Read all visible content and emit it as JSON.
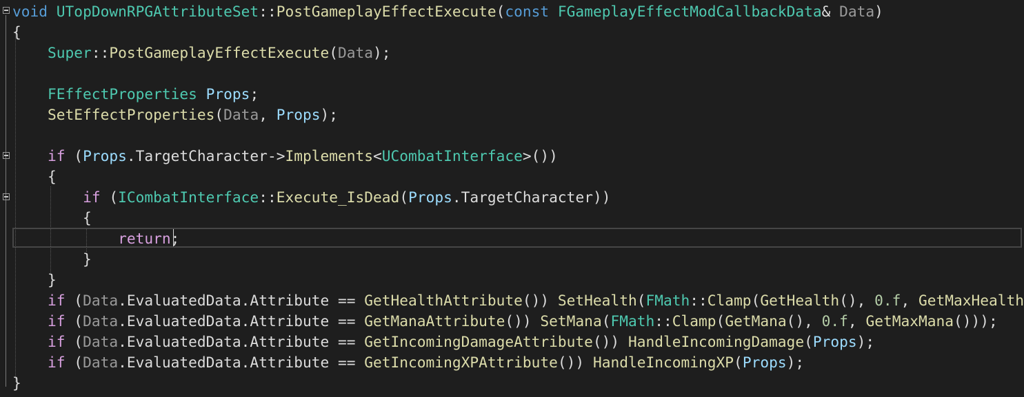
{
  "editor": {
    "theme_colors": {
      "background": "#1e1e1e",
      "keyword": "#569cd6",
      "control": "#d8a0df",
      "type": "#4ec9b0",
      "function": "#dcdcaa",
      "parameter": "#9a9a9a",
      "local": "#9cdcfe",
      "plain": "#dcdcdc",
      "number": "#b5cea8"
    },
    "lines": [
      [
        {
          "c": "kw",
          "t": "void"
        },
        {
          "c": "plain",
          "t": " "
        },
        {
          "c": "type",
          "t": "UTopDownRPGAttributeSet"
        },
        {
          "c": "plain",
          "t": "::"
        },
        {
          "c": "fn",
          "t": "PostGameplayEffectExecute"
        },
        {
          "c": "plain",
          "t": "("
        },
        {
          "c": "kw",
          "t": "const"
        },
        {
          "c": "plain",
          "t": " "
        },
        {
          "c": "type",
          "t": "FGameplayEffectModCallbackData"
        },
        {
          "c": "plain",
          "t": "& "
        },
        {
          "c": "param",
          "t": "Data"
        },
        {
          "c": "plain",
          "t": ")"
        }
      ],
      [
        {
          "c": "plain",
          "t": "{"
        }
      ],
      [
        {
          "c": "plain",
          "t": "    "
        },
        {
          "c": "type",
          "t": "Super"
        },
        {
          "c": "plain",
          "t": "::"
        },
        {
          "c": "fn",
          "t": "PostGameplayEffectExecute"
        },
        {
          "c": "plain",
          "t": "("
        },
        {
          "c": "param",
          "t": "Data"
        },
        {
          "c": "plain",
          "t": ");"
        }
      ],
      [],
      [
        {
          "c": "plain",
          "t": "    "
        },
        {
          "c": "type",
          "t": "FEffectProperties"
        },
        {
          "c": "plain",
          "t": " "
        },
        {
          "c": "local",
          "t": "Props"
        },
        {
          "c": "plain",
          "t": ";"
        }
      ],
      [
        {
          "c": "plain",
          "t": "    "
        },
        {
          "c": "fn",
          "t": "SetEffectProperties"
        },
        {
          "c": "plain",
          "t": "("
        },
        {
          "c": "param",
          "t": "Data"
        },
        {
          "c": "plain",
          "t": ", "
        },
        {
          "c": "local",
          "t": "Props"
        },
        {
          "c": "plain",
          "t": ");"
        }
      ],
      [],
      [
        {
          "c": "plain",
          "t": "    "
        },
        {
          "c": "ctl",
          "t": "if"
        },
        {
          "c": "plain",
          "t": " ("
        },
        {
          "c": "local",
          "t": "Props"
        },
        {
          "c": "plain",
          "t": ".TargetCharacter->"
        },
        {
          "c": "fn",
          "t": "Implements"
        },
        {
          "c": "plain",
          "t": "<"
        },
        {
          "c": "type",
          "t": "UCombatInterface"
        },
        {
          "c": "plain",
          "t": ">())"
        }
      ],
      [
        {
          "c": "plain",
          "t": "    {"
        }
      ],
      [
        {
          "c": "plain",
          "t": "        "
        },
        {
          "c": "ctl",
          "t": "if"
        },
        {
          "c": "plain",
          "t": " ("
        },
        {
          "c": "type",
          "t": "ICombatInterface"
        },
        {
          "c": "plain",
          "t": "::"
        },
        {
          "c": "fn",
          "t": "Execute_IsDead"
        },
        {
          "c": "plain",
          "t": "("
        },
        {
          "c": "local",
          "t": "Props"
        },
        {
          "c": "plain",
          "t": ".TargetCharacter))"
        }
      ],
      [
        {
          "c": "plain",
          "t": "        {"
        }
      ],
      [
        {
          "c": "plain",
          "t": "            "
        },
        {
          "c": "ctl",
          "t": "return"
        },
        {
          "c": "plain",
          "t": ";"
        }
      ],
      [
        {
          "c": "plain",
          "t": "        }"
        }
      ],
      [
        {
          "c": "plain",
          "t": "    }"
        }
      ],
      [
        {
          "c": "plain",
          "t": "    "
        },
        {
          "c": "ctl",
          "t": "if"
        },
        {
          "c": "plain",
          "t": " ("
        },
        {
          "c": "param",
          "t": "Data"
        },
        {
          "c": "plain",
          "t": ".EvaluatedData.Attribute == "
        },
        {
          "c": "fn",
          "t": "GetHealthAttribute"
        },
        {
          "c": "plain",
          "t": "()) "
        },
        {
          "c": "fn",
          "t": "SetHealth"
        },
        {
          "c": "plain",
          "t": "("
        },
        {
          "c": "type",
          "t": "FMath"
        },
        {
          "c": "plain",
          "t": "::"
        },
        {
          "c": "fn",
          "t": "Clamp"
        },
        {
          "c": "plain",
          "t": "("
        },
        {
          "c": "fn",
          "t": "GetHealth"
        },
        {
          "c": "plain",
          "t": "(), "
        },
        {
          "c": "num",
          "t": "0.f"
        },
        {
          "c": "plain",
          "t": ", "
        },
        {
          "c": "fn",
          "t": "GetMaxHealth"
        },
        {
          "c": "plain",
          "t": "()));"
        }
      ],
      [
        {
          "c": "plain",
          "t": "    "
        },
        {
          "c": "ctl",
          "t": "if"
        },
        {
          "c": "plain",
          "t": " ("
        },
        {
          "c": "param",
          "t": "Data"
        },
        {
          "c": "plain",
          "t": ".EvaluatedData.Attribute == "
        },
        {
          "c": "fn",
          "t": "GetManaAttribute"
        },
        {
          "c": "plain",
          "t": "()) "
        },
        {
          "c": "fn",
          "t": "SetMana"
        },
        {
          "c": "plain",
          "t": "("
        },
        {
          "c": "type",
          "t": "FMath"
        },
        {
          "c": "plain",
          "t": "::"
        },
        {
          "c": "fn",
          "t": "Clamp"
        },
        {
          "c": "plain",
          "t": "("
        },
        {
          "c": "fn",
          "t": "GetMana"
        },
        {
          "c": "plain",
          "t": "(), "
        },
        {
          "c": "num",
          "t": "0.f"
        },
        {
          "c": "plain",
          "t": ", "
        },
        {
          "c": "fn",
          "t": "GetMaxMana"
        },
        {
          "c": "plain",
          "t": "()));"
        }
      ],
      [
        {
          "c": "plain",
          "t": "    "
        },
        {
          "c": "ctl",
          "t": "if"
        },
        {
          "c": "plain",
          "t": " ("
        },
        {
          "c": "param",
          "t": "Data"
        },
        {
          "c": "plain",
          "t": ".EvaluatedData.Attribute == "
        },
        {
          "c": "fn",
          "t": "GetIncomingDamageAttribute"
        },
        {
          "c": "plain",
          "t": "()) "
        },
        {
          "c": "fn",
          "t": "HandleIncomingDamage"
        },
        {
          "c": "plain",
          "t": "("
        },
        {
          "c": "local",
          "t": "Props"
        },
        {
          "c": "plain",
          "t": ");"
        }
      ],
      [
        {
          "c": "plain",
          "t": "    "
        },
        {
          "c": "ctl",
          "t": "if"
        },
        {
          "c": "plain",
          "t": " ("
        },
        {
          "c": "param",
          "t": "Data"
        },
        {
          "c": "plain",
          "t": ".EvaluatedData.Attribute == "
        },
        {
          "c": "fn",
          "t": "GetIncomingXPAttribute"
        },
        {
          "c": "plain",
          "t": "()) "
        },
        {
          "c": "fn",
          "t": "HandleIncomingXP"
        },
        {
          "c": "plain",
          "t": "("
        },
        {
          "c": "local",
          "t": "Props"
        },
        {
          "c": "plain",
          "t": ");"
        }
      ],
      [
        {
          "c": "plain",
          "t": "}"
        }
      ]
    ]
  }
}
